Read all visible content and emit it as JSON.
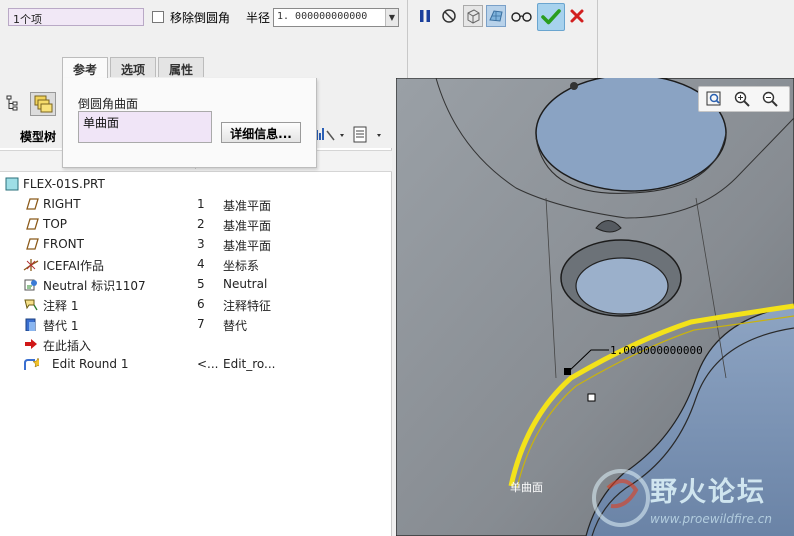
{
  "dashboard": {
    "selection_summary": "1个项",
    "remove_rounds_label": "移除倒圆角",
    "radius_label": "半径",
    "radius_value": "1. 000000000000",
    "tabs": [
      {
        "label": "参考"
      },
      {
        "label": "选项"
      },
      {
        "label": "属性"
      }
    ]
  },
  "references_panel": {
    "label": "倒圆角曲面",
    "items": [
      "单曲面"
    ],
    "details_button": "详细信息..."
  },
  "model_tree": {
    "title": "模型树",
    "root": "FLEX-01S.PRT",
    "rows": [
      {
        "name": "RIGHT",
        "col2": "1",
        "col3": "基准平面",
        "icon": "datum-plane-icon"
      },
      {
        "name": "TOP",
        "col2": "2",
        "col3": "基准平面",
        "icon": "datum-plane-icon"
      },
      {
        "name": "FRONT",
        "col2": "3",
        "col3": "基准平面",
        "icon": "datum-plane-icon"
      },
      {
        "name": "ICEFAI作品",
        "col2": "4",
        "col3": "坐标系",
        "icon": "coordinate-system-icon"
      },
      {
        "name": "Neutral 标识1107",
        "col2": "5",
        "col3": "Neutral",
        "icon": "neutral-icon"
      },
      {
        "name": "注释 1",
        "col2": "6",
        "col3": "注释特征",
        "icon": "annotation-icon"
      },
      {
        "name": "替代 1",
        "col2": "7",
        "col3": "替代",
        "icon": "substitute-icon"
      },
      {
        "name": "在此插入",
        "col2": "",
        "col3": "",
        "icon": "insert-here-icon"
      },
      {
        "name": "Edit Round 1",
        "col2": "<...",
        "col3": "Edit_ro...",
        "icon": "edit-round-icon"
      }
    ]
  },
  "viewport": {
    "radius_callout": "1.000000000000",
    "surface_label": "单曲面",
    "watermark_title": "野火论坛",
    "watermark_url": "www.proewildfire.cn"
  },
  "colors": {
    "ok_green": "#2a9d1e",
    "cancel_red": "#d21f1f",
    "highlight_yellow": "#f3e21a",
    "part_gray": "#8b9095"
  }
}
